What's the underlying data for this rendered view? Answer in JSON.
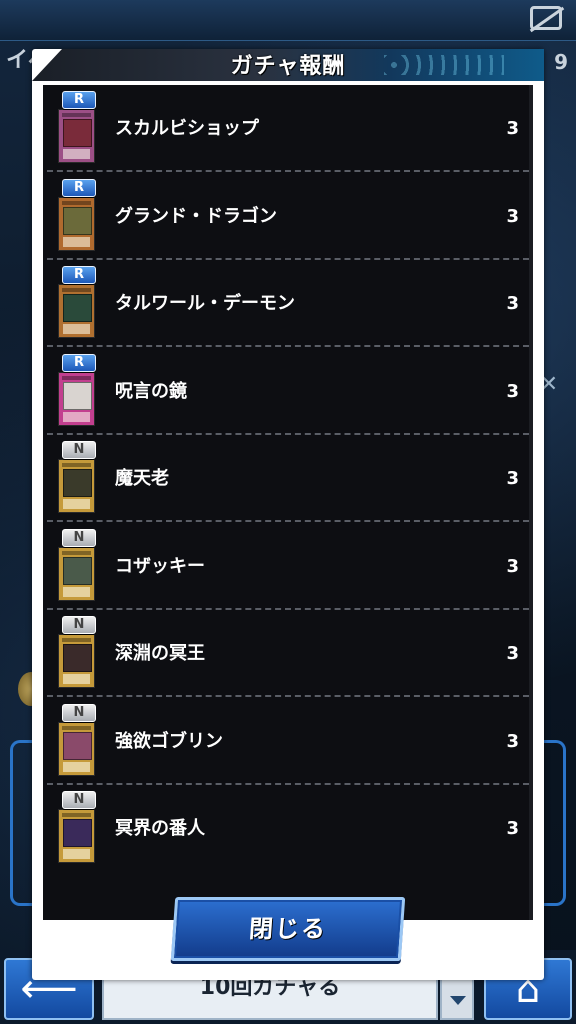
{
  "background": {
    "title": "イベ",
    "right_number": "9",
    "gacha_button_label": "10回ガチャる",
    "icons": [
      "offline-icon",
      "back-arrow-icon",
      "home-icon",
      "dropdown-arrow-icon",
      "coin-icon"
    ]
  },
  "modal": {
    "title": "ガチャ報酬",
    "close_label": "閉じる",
    "items": [
      {
        "rarity": "R",
        "name": "スカルビショップ",
        "count": "3",
        "card_color": "#9c4f86",
        "art_color": "#7a2b3a"
      },
      {
        "rarity": "R",
        "name": "グランド・ドラゴン",
        "count": "3",
        "card_color": "#b06a2e",
        "art_color": "#6b6a3a"
      },
      {
        "rarity": "R",
        "name": "タルワール・デーモン",
        "count": "3",
        "card_color": "#b07030",
        "art_color": "#2a4a3a"
      },
      {
        "rarity": "R",
        "name": "呪言の鏡",
        "count": "3",
        "card_color": "#c23f8f",
        "art_color": "#d9d4d0"
      },
      {
        "rarity": "N",
        "name": "魔天老",
        "count": "3",
        "card_color": "#c59a3a",
        "art_color": "#3a3a2a"
      },
      {
        "rarity": "N",
        "name": "コザッキー",
        "count": "3",
        "card_color": "#c59a3a",
        "art_color": "#4a5a4a"
      },
      {
        "rarity": "N",
        "name": "深淵の冥王",
        "count": "3",
        "card_color": "#c59a3a",
        "art_color": "#3a2a2a"
      },
      {
        "rarity": "N",
        "name": "強欲ゴブリン",
        "count": "3",
        "card_color": "#c59a3a",
        "art_color": "#8a4a6a"
      },
      {
        "rarity": "N",
        "name": "冥界の番人",
        "count": "3",
        "card_color": "#c59a3a",
        "art_color": "#3a2a5a"
      }
    ]
  }
}
